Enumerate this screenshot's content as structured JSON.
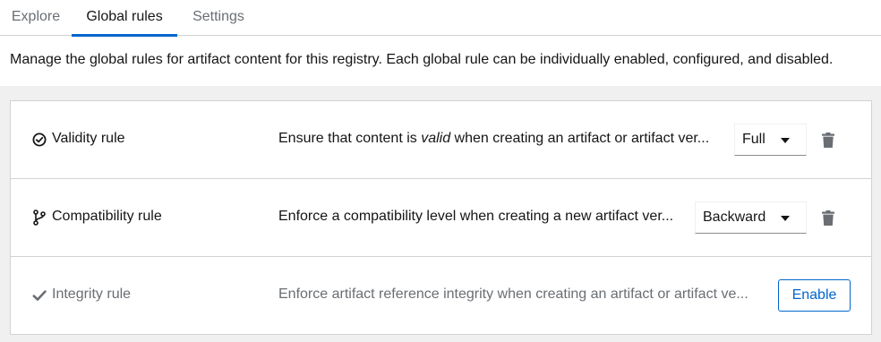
{
  "tabs": [
    {
      "label": "Explore"
    },
    {
      "label": "Global rules"
    },
    {
      "label": "Settings"
    }
  ],
  "description": "Manage the global rules for artifact content for this registry. Each global rule can be individually enabled, configured, and disabled.",
  "rules": [
    {
      "name": "Validity rule",
      "icon": "check-circle-icon",
      "text_before": "Ensure that content is ",
      "text_em": "valid",
      "text_after": " when creating an artifact or artifact ver...",
      "value": "Full"
    },
    {
      "name": "Compatibility rule",
      "icon": "code-branch-icon",
      "text": "Enforce a compatibility level when creating a new artifact ver...",
      "value": "Backward"
    },
    {
      "name": "Integrity rule",
      "icon": "checkmark-icon",
      "text": "Enforce artifact reference integrity when creating an artifact or artifact ve...",
      "action": "Enable"
    }
  ],
  "colors": {
    "accent": "#0066cc",
    "text": "#151515",
    "muted": "#6a6e73",
    "border": "#d2d2d2",
    "background": "#f0f0f0"
  }
}
